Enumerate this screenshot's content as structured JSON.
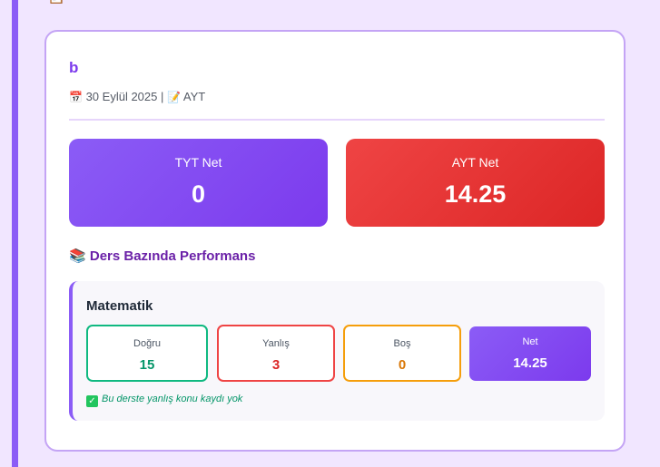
{
  "record": {
    "name": "b",
    "date": "30 Eylül 2025",
    "separator": "|",
    "exam_type": "AYT",
    "calendar_icon": "📅",
    "memo_icon": "📝"
  },
  "nets": {
    "tyt": {
      "label": "TYT Net",
      "value": "0"
    },
    "ayt": {
      "label": "AYT Net",
      "value": "14.25"
    }
  },
  "section": {
    "icon": "📚",
    "title": "Ders Bazında Performans"
  },
  "subject": {
    "name": "Matematik",
    "dogru": {
      "label": "Doğru",
      "value": "15"
    },
    "yanlis": {
      "label": "Yanlış",
      "value": "3"
    },
    "bos": {
      "label": "Boş",
      "value": "0"
    },
    "net": {
      "label": "Net",
      "value": "14.25"
    },
    "note": "Bu derste yanlış konu kaydı yok"
  },
  "colors": {
    "accent": "#8b5cf6",
    "tyt_bg": "#7c3aed",
    "ayt_bg": "#dc2626",
    "success": "#10b981",
    "danger": "#ef4444",
    "warning": "#f59e0b"
  }
}
